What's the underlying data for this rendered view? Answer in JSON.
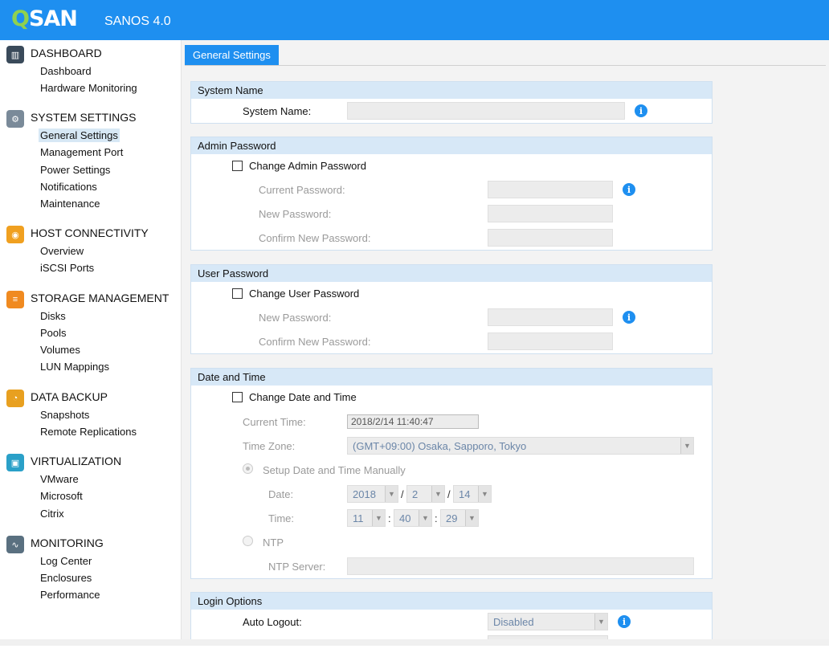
{
  "header": {
    "logo": "QSAN",
    "product": "SANOS 4.0"
  },
  "sidebar": {
    "sections": [
      {
        "title": "DASHBOARD",
        "icon": "dashboard-icon",
        "items": [
          "Dashboard",
          "Hardware Monitoring"
        ]
      },
      {
        "title": "SYSTEM SETTINGS",
        "icon": "system-settings-icon",
        "items": [
          "General Settings",
          "Management Port",
          "Power Settings",
          "Notifications",
          "Maintenance"
        ]
      },
      {
        "title": "HOST CONNECTIVITY",
        "icon": "host-connectivity-icon",
        "items": [
          "Overview",
          "iSCSI Ports"
        ]
      },
      {
        "title": "STORAGE MANAGEMENT",
        "icon": "storage-icon",
        "items": [
          "Disks",
          "Pools",
          "Volumes",
          "LUN Mappings"
        ]
      },
      {
        "title": "DATA BACKUP",
        "icon": "backup-icon",
        "items": [
          "Snapshots",
          "Remote Replications"
        ]
      },
      {
        "title": "VIRTUALIZATION",
        "icon": "virtualization-icon",
        "items": [
          "VMware",
          "Microsoft",
          "Citrix"
        ]
      },
      {
        "title": "MONITORING",
        "icon": "monitoring-icon",
        "items": [
          "Log Center",
          "Enclosures",
          "Performance"
        ]
      }
    ],
    "active_item": "General Settings"
  },
  "main": {
    "tab": "General Settings",
    "system_name": {
      "title": "System Name",
      "label": "System Name:",
      "value": ""
    },
    "admin_password": {
      "title": "Admin Password",
      "checkbox": "Change Admin Password",
      "current": "Current Password:",
      "new": "New Password:",
      "confirm": "Confirm New Password:"
    },
    "user_password": {
      "title": "User Password",
      "checkbox": "Change User Password",
      "new": "New Password:",
      "confirm": "Confirm New Password:"
    },
    "date_time": {
      "title": "Date and Time",
      "checkbox": "Change Date and Time",
      "current_time_label": "Current Time:",
      "current_time": "2018/2/14 11:40:47",
      "time_zone_label": "Time Zone:",
      "time_zone": "(GMT+09:00) Osaka, Sapporo, Tokyo",
      "manual_label": "Setup Date and Time Manually",
      "date_label": "Date:",
      "date_year": "2018",
      "date_month": "2",
      "date_day": "14",
      "date_sep": "/",
      "time_label": "Time:",
      "time_h": "11",
      "time_m": "40",
      "time_s": "29",
      "time_sep": ":",
      "ntp_label": "NTP",
      "ntp_server_label": "NTP Server:"
    },
    "login_options": {
      "title": "Login Options",
      "auto_logout_label": "Auto Logout:",
      "auto_logout": "Disabled"
    }
  },
  "colors": {
    "brand": "#1e8ff0",
    "accent_green": "#8fd14f",
    "panel_head": "#d7e8f7"
  }
}
